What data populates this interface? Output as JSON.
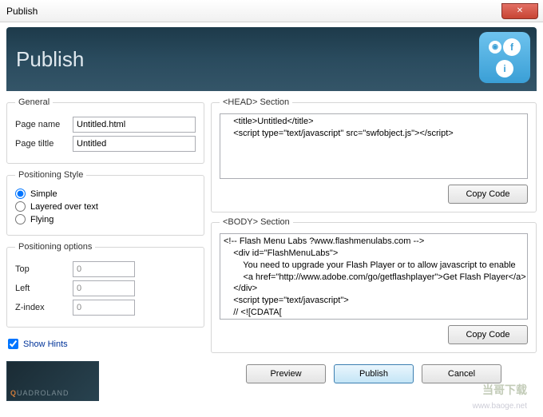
{
  "window": {
    "title": "Publish"
  },
  "header": {
    "title": "Publish"
  },
  "general": {
    "legend": "General",
    "page_name_label": "Page name",
    "page_name_value": "Untitled.html",
    "page_title_label": "Page tiltle",
    "page_title_value": "Untitled"
  },
  "pos_style": {
    "legend": "Positioning Style",
    "options": {
      "simple": "Simple",
      "layered": "Layered over text",
      "flying": "Flying"
    },
    "selected": "simple"
  },
  "pos_opts": {
    "legend": "Positioning options",
    "top_label": "Top",
    "top_value": "0",
    "left_label": "Left",
    "left_value": "0",
    "zindex_label": "Z-index",
    "zindex_value": "0"
  },
  "show_hints": {
    "label": "Show Hints",
    "checked": true
  },
  "logo": {
    "text": "UADROLAND",
    "accent": "Q"
  },
  "head_section": {
    "legend": "<HEAD> Section",
    "code": "    <title>Untitled</title>\n    <script type=\"text/javascript\" src=\"swfobject.js\"></script>",
    "copy_label": "Copy Code"
  },
  "body_section": {
    "legend": "<BODY> Section",
    "code": "<!-- Flash Menu Labs ?www.flashmenulabs.com -->\n    <div id=\"FlashMenuLabs\">\n        You need to upgrade your Flash Player or to allow javascript to enable \n        <a href=\"http://www.adobe.com/go/getflashplayer\">Get Flash Player</a>\n    </div>\n    <script type=\"text/javascript\">\n    // <![CDATA[",
    "copy_label": "Copy Code"
  },
  "footer": {
    "preview": "Preview",
    "publish": "Publish",
    "cancel": "Cancel"
  },
  "watermark": {
    "main": "当哥下载",
    "url": "www.baoge.net"
  }
}
